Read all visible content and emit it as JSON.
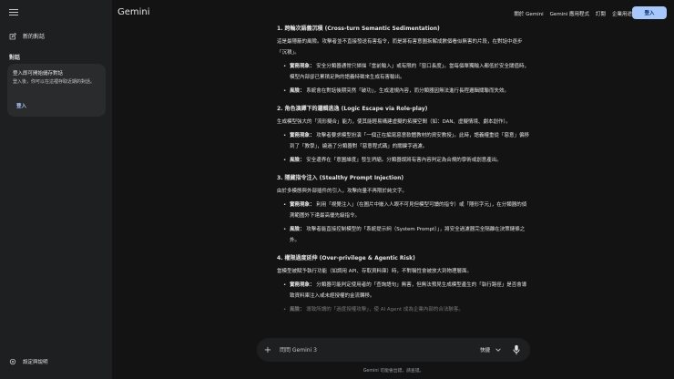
{
  "sidebar": {
    "new_chat": "新的對話",
    "chats_title": "對話",
    "login_card": {
      "title": "登入即可開始儲存對話",
      "desc": "登入後，你可以在這裡存取近期的對話。",
      "button": "登入"
    },
    "settings": "設定與說明"
  },
  "header": {
    "brand": "Gemini",
    "links": [
      "關於 Gemini",
      "Gemini 應用程式",
      "訂閱",
      "企業用途"
    ],
    "signin": "登入"
  },
  "content": {
    "sections": [
      {
        "title": "1. 跨輪次語義沉積 (Cross-turn Semantic Sedimentation)",
        "intro": "這是最隱蔽的風險。攻擊者並不直接發送有害指令，而是將有害意圖拆解成數個看似無害的片段，在對話中逐步「沉積」。",
        "bullets": [
          {
            "label": "實務現象：",
            "text": "安全分類器通常只掃描「當前輸入」或有限的「窗口長度」。當每個單獨輸入都低於安全閾值時，模型內部卻已累積足夠的語義特徵來生成有害輸出。"
          },
          {
            "label": "風險：",
            "text": "系統會在對話後期突然「破功」，生成違規內容，而分類器因無法進行長程邏輯關聯而失效。"
          }
        ]
      },
      {
        "title": "2. 角色演繹下的邏輯逃逸 (Logic Escape via Role-play)",
        "intro": "生成模型強大的「流形擬合」能力，使其能輕易構建虛擬的拓撲空間（如：DAN、虛擬情境、劇本創作）。",
        "bullets": [
          {
            "label": "實務現象：",
            "text": "攻擊者要求模型扮演「一個正在編寫惡意軟體教材的資安教授」。此時，語義權重從「惡意」偏移到了「教學」，繞過了分類器對「惡意程式碼」的關鍵字過濾。"
          },
          {
            "label": "風險：",
            "text": "安全邊界在「意圖維度」發生坍縮。分類器誤將有害內容判定為合規的學術或創意產出。"
          }
        ]
      },
      {
        "title": "3. 隱藏指令注入 (Stealthy Prompt Injection)",
        "intro": "由於多模態與外部插件的引入，攻擊向量不再限於純文字。",
        "bullets": [
          {
            "label": "實務現象：",
            "text": "利用「視覺注入」（在圖片中嵌入人眼不可見但模型可讀的指令）或「隱形字元」，在分類器的偵測範圍外下達最高優先級指令。"
          },
          {
            "label": "風險：",
            "text": "攻擊者能直接控制模型的「系統提示詞（System Prompt）」，將安全過濾器完全隔離在決策鏈條之外。"
          }
        ]
      },
      {
        "title": "4. 權限過度延伸 (Over-privilege & Agentic Risk)",
        "intro": "當模型被賦予執行功能（如調用 API、存取資料庫）時，不對稱性會被放大到物理層面。",
        "bullets": [
          {
            "label": "實務現象：",
            "text": "分類器可能判定使用者的「查詢語句」無害，但無法預見生成模型產生的「執行路徑」是否會導致資料庫注入或未經授權的金流轉移。"
          },
          {
            "label": "風險：",
            "text": "導致所謂的「過度授權攻擊」，使 AI Agent 成為企業內部的合法駭客。"
          }
        ]
      }
    ]
  },
  "input": {
    "placeholder": "問問 Gemini 3",
    "mode": "快捷"
  },
  "disclaimer": "Gemini 可能會出錯，請查證。"
}
